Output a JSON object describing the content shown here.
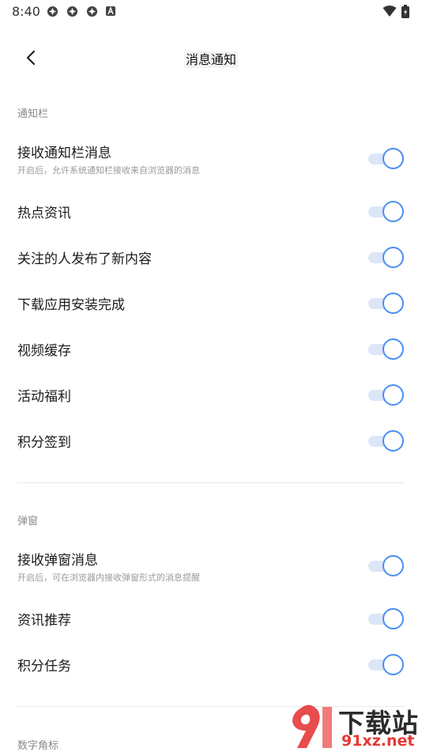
{
  "status_bar": {
    "time": "8:40"
  },
  "header": {
    "title": "消息通知"
  },
  "sections": [
    {
      "label": "通知栏",
      "items": [
        {
          "title": "接收通知栏消息",
          "subtitle": "开启后，允许系统通知栏接收来自浏览器的消息",
          "on": true
        },
        {
          "title": "热点资讯",
          "on": true
        },
        {
          "title": "关注的人发布了新内容",
          "on": true
        },
        {
          "title": "下载应用安装完成",
          "on": true
        },
        {
          "title": "视频缓存",
          "on": true
        },
        {
          "title": "活动福利",
          "on": true
        },
        {
          "title": "积分签到",
          "on": true
        }
      ]
    },
    {
      "label": "弹窗",
      "items": [
        {
          "title": "接收弹窗消息",
          "subtitle": "开启后，可在浏览器内接收弹窗形式的消息提醒",
          "on": true
        },
        {
          "title": "资讯推荐",
          "on": true
        },
        {
          "title": "积分任务",
          "on": true
        }
      ]
    },
    {
      "label": "数字角标",
      "items": []
    }
  ],
  "watermark": {
    "text_main": "下载站",
    "text_sub": "91xz.net"
  },
  "colors": {
    "accent": "#4a8ff2",
    "track": "#dce6f7",
    "divider": "#e9e9e9"
  }
}
